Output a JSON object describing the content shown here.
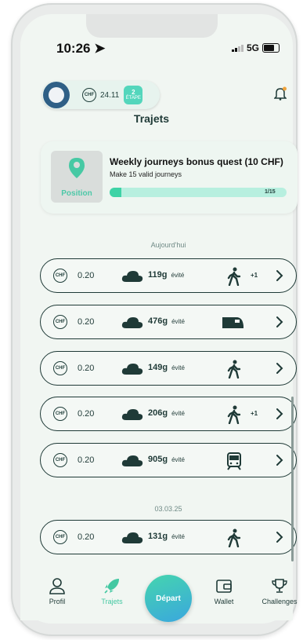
{
  "status": {
    "time": "10:26",
    "network": "5G"
  },
  "header": {
    "currency": "CHF",
    "balance": "24.11",
    "etape_count": "2",
    "etape_label": "ÉTAPE",
    "title": "Trajets"
  },
  "quest": {
    "image_label": "Position",
    "title": "Weekly journeys bonus quest (10 CHF)",
    "subtitle": "Make 15 valid journeys",
    "progress_label": "1/15",
    "progress_fraction": 0.0667
  },
  "sections": [
    {
      "date": "Aujourd'hui"
    },
    {
      "date": "03.03.25"
    }
  ],
  "trips": [
    {
      "amount": "0.20",
      "co2": "119g",
      "evite": "évité",
      "mode": "walk-icon",
      "extra": "+1"
    },
    {
      "amount": "0.20",
      "co2": "476g",
      "evite": "évité",
      "mode": "train-icon",
      "extra": ""
    },
    {
      "amount": "0.20",
      "co2": "149g",
      "evite": "évité",
      "mode": "walk-icon",
      "extra": ""
    },
    {
      "amount": "0.20",
      "co2": "206g",
      "evite": "évité",
      "mode": "walk-icon",
      "extra": "+1"
    },
    {
      "amount": "0.20",
      "co2": "905g",
      "evite": "évité",
      "mode": "tram-icon",
      "extra": ""
    },
    {
      "amount": "0.20",
      "co2": "131g",
      "evite": "évité",
      "mode": "walk-icon",
      "extra": ""
    }
  ],
  "tabs": {
    "profil": "Profil",
    "trajets": "Trajets",
    "depart": "Départ",
    "wallet": "Wallet",
    "challenges": "Challenges"
  },
  "colors": {
    "accent": "#43c8a2",
    "dark": "#1f3a37",
    "background": "#f1f6f2"
  }
}
